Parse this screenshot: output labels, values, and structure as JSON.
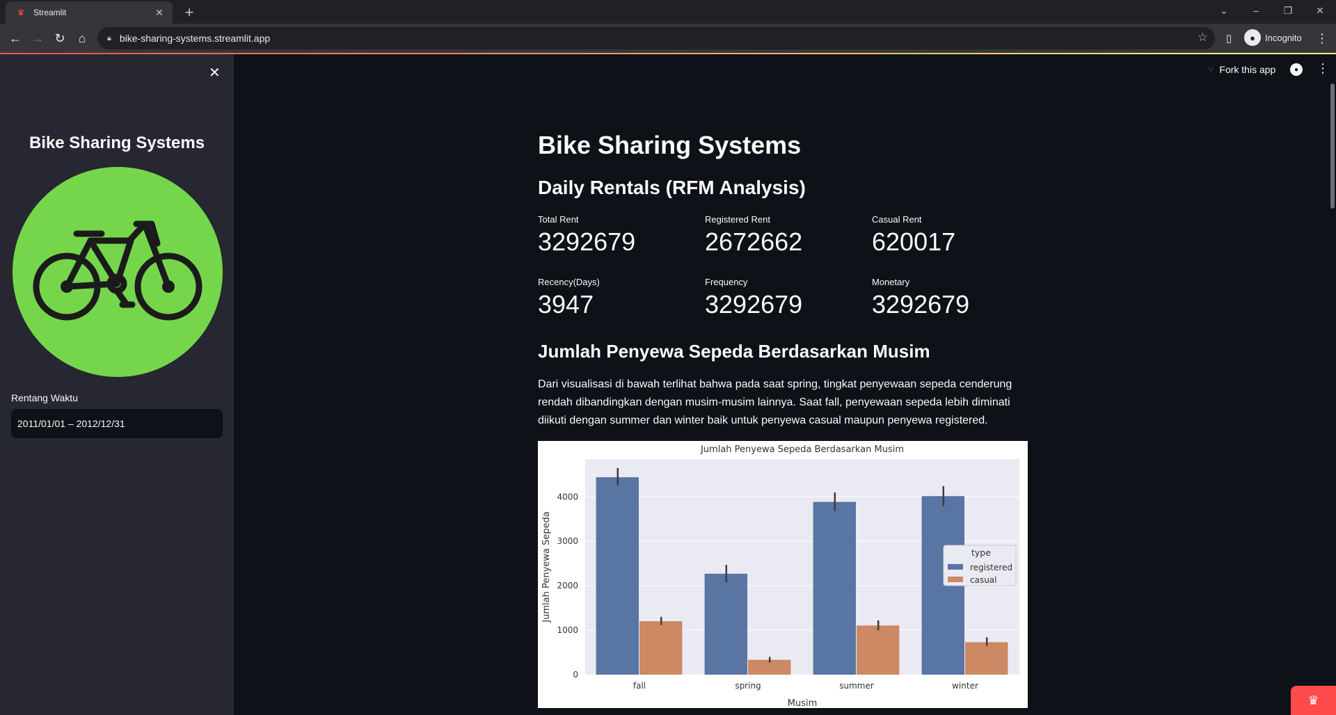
{
  "browser": {
    "tab_title": "Streamlit",
    "url": "bike-sharing-systems.streamlit.app",
    "profile": "Incognito"
  },
  "sidebar": {
    "title": "Bike Sharing Systems",
    "date_label": "Rentang Waktu",
    "date_value": "2011/01/01 – 2012/12/31",
    "logo_color": "#76d64b"
  },
  "header": {
    "fork_label": "Fork this app"
  },
  "main": {
    "title": "Bike Sharing Systems",
    "subtitle": "Daily Rentals (RFM Analysis)",
    "metrics": [
      {
        "label": "Total Rent",
        "value": "3292679"
      },
      {
        "label": "Registered Rent",
        "value": "2672662"
      },
      {
        "label": "Casual Rent",
        "value": "620017"
      },
      {
        "label": "Recency(Days)",
        "value": "3947"
      },
      {
        "label": "Frequency",
        "value": "3292679"
      },
      {
        "label": "Monetary",
        "value": "3292679"
      }
    ],
    "section_title": "Jumlah Penyewa Sepeda Berdasarkan Musim",
    "paragraph": "Dari visualisasi di bawah terlihat bahwa pada saat spring, tingkat penyewaan sepeda cenderung rendah dibandingkan dengan musim-musim lainnya. Saat fall, penyewaan sepeda lebih diminati diikuti dengan summer dan winter baik untuk penyewa casual maupun penyewa registered."
  },
  "chart_data": {
    "type": "bar",
    "title": "Jumlah Penyewa Sepeda Berdasarkan Musim",
    "xlabel": "Musim",
    "ylabel": "Jumlah Penyewa Sepeda",
    "categories": [
      "fall",
      "spring",
      "summer",
      "winter"
    ],
    "ylim": [
      0,
      4850
    ],
    "yticks": [
      0,
      1000,
      2000,
      3000,
      4000
    ],
    "legend_title": "type",
    "legend_position": "right",
    "grid": true,
    "series": [
      {
        "name": "registered",
        "color": "#5875a4",
        "values": [
          4441,
          2270,
          3886,
          4016
        ],
        "err": [
          [
            4250,
            4650
          ],
          [
            2080,
            2470
          ],
          [
            3680,
            4100
          ],
          [
            3790,
            4240
          ]
        ]
      },
      {
        "name": "casual",
        "color": "#cc8963",
        "values": [
          1203,
          334,
          1106,
          730
        ],
        "err": [
          [
            1120,
            1300
          ],
          [
            270,
            400
          ],
          [
            1000,
            1220
          ],
          [
            650,
            840
          ]
        ]
      }
    ]
  }
}
